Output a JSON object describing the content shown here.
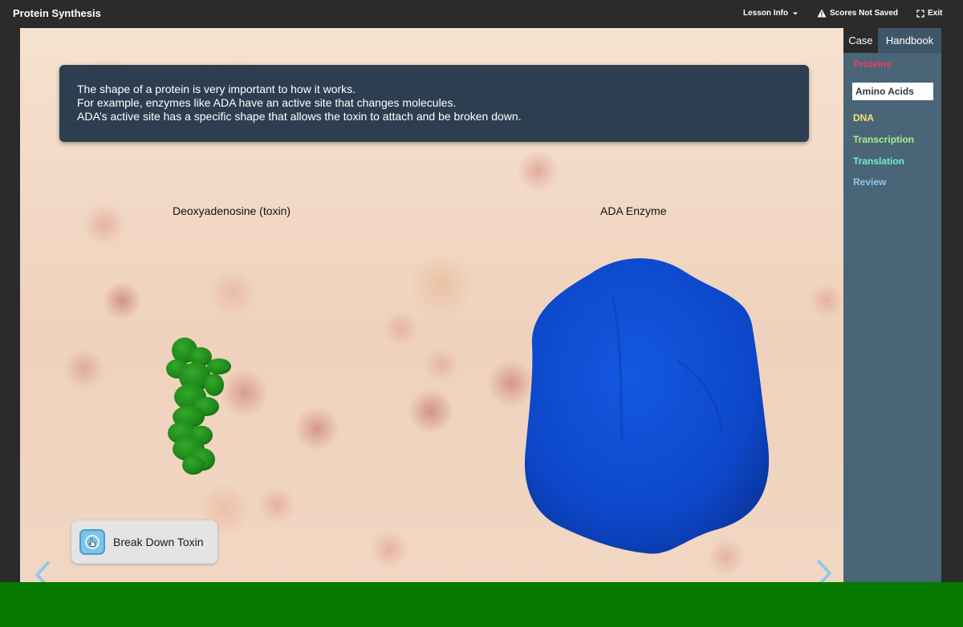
{
  "app": {
    "title": "Protein Synthesis"
  },
  "topnav": {
    "lesson_info": "Lesson Info",
    "scores": "Scores Not Saved",
    "exit": "Exit"
  },
  "info_box": {
    "lines": [
      "The shape of a protein is very important to how it works.",
      "For example, enzymes like ADA have an active site that changes molecules.",
      "ADA’s active site has a specific shape that allows the toxin to attach and be broken down."
    ]
  },
  "labels": {
    "toxin": "Deoxyadenosine (toxin)",
    "enzyme": "ADA Enzyme"
  },
  "action_button": {
    "label": "Break Down Toxin"
  },
  "sidebar": {
    "tabs": {
      "case": "Case",
      "handbook": "Handbook"
    },
    "items": [
      {
        "label": "Proteins",
        "color": "#e8435b"
      },
      {
        "label": "Amino Acids",
        "color": "#2b3a47"
      },
      {
        "label": "DNA",
        "color": "#f2e36a"
      },
      {
        "label": "Transcription",
        "color": "#a8f08a"
      },
      {
        "label": "Translation",
        "color": "#6ff0c8"
      },
      {
        "label": "Review",
        "color": "#8ec6f0"
      }
    ]
  },
  "colors": {
    "toxin_molecule": "#1f8a1a",
    "enzyme_molecule": "#0d47c9",
    "overlay_band": "#067a00"
  },
  "icons": {
    "lesson_info": "chevron-down-icon",
    "scores": "warning-icon",
    "exit": "exit-icon",
    "action": "pointer-hand-icon",
    "prev": "arrow-left-icon",
    "next": "arrow-right-icon"
  }
}
